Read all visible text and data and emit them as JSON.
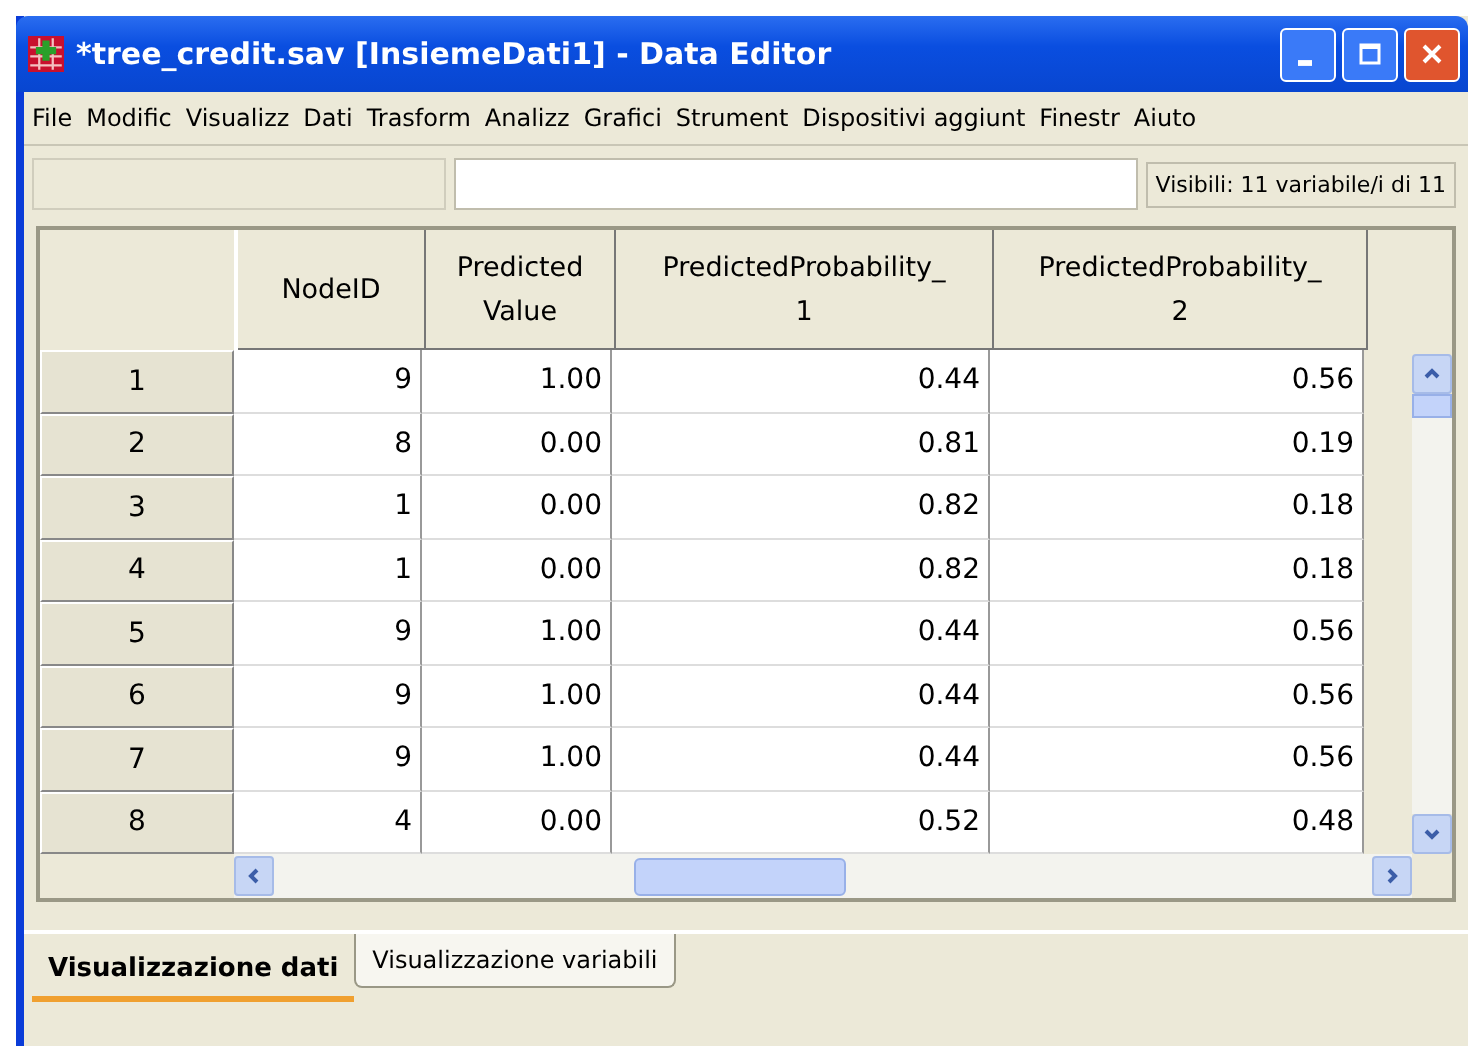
{
  "window": {
    "title": "*tree_credit.sav [InsiemeDati1] - Data Editor"
  },
  "menu": [
    {
      "label": "File"
    },
    {
      "label": "Modific"
    },
    {
      "label": "Visualizz"
    },
    {
      "label": "Dati"
    },
    {
      "label": "Trasform"
    },
    {
      "label": "Analizz"
    },
    {
      "label": "Grafici"
    },
    {
      "label": "Strument"
    },
    {
      "label": "Dispositivi aggiunt"
    },
    {
      "label": "Finestr"
    },
    {
      "label": "Aiuto"
    }
  ],
  "info_bar": {
    "status": "Visibili: 11 variabile/i di 11"
  },
  "table": {
    "columns": [
      {
        "label": "NodeID"
      },
      {
        "label": "Predicted Value"
      },
      {
        "label": "PredictedProbability_ 1"
      },
      {
        "label": "PredictedProbability_ 2"
      }
    ],
    "rows": [
      {
        "number": "1",
        "cells": [
          "9",
          "1.00",
          "0.44",
          "0.56"
        ]
      },
      {
        "number": "2",
        "cells": [
          "8",
          "0.00",
          "0.81",
          "0.19"
        ]
      },
      {
        "number": "3",
        "cells": [
          "1",
          "0.00",
          "0.82",
          "0.18"
        ]
      },
      {
        "number": "4",
        "cells": [
          "1",
          "0.00",
          "0.82",
          "0.18"
        ]
      },
      {
        "number": "5",
        "cells": [
          "9",
          "1.00",
          "0.44",
          "0.56"
        ]
      },
      {
        "number": "6",
        "cells": [
          "9",
          "1.00",
          "0.44",
          "0.56"
        ]
      },
      {
        "number": "7",
        "cells": [
          "9",
          "1.00",
          "0.44",
          "0.56"
        ]
      },
      {
        "number": "8",
        "cells": [
          "4",
          "0.00",
          "0.52",
          "0.48"
        ]
      }
    ]
  },
  "tabs": [
    {
      "label": "Visualizzazione dati",
      "selected": true
    },
    {
      "label": "Visualizzazione variabili",
      "selected": false
    }
  ]
}
